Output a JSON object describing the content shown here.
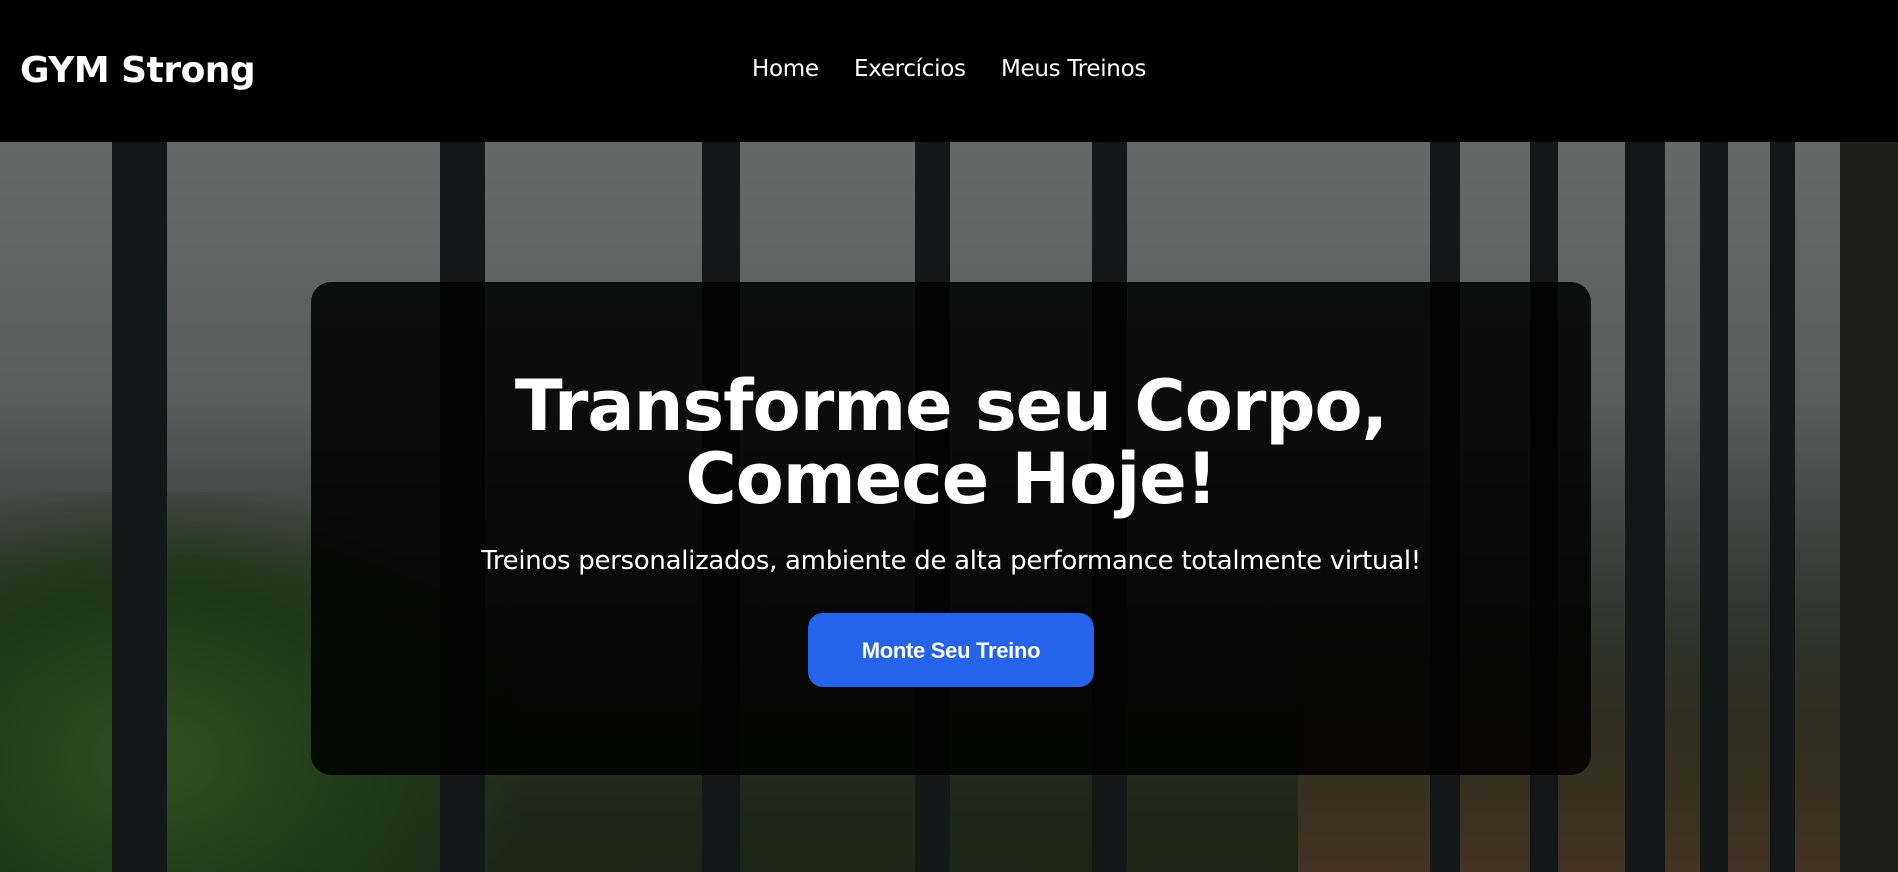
{
  "header": {
    "logo": "GYM Strong",
    "nav": [
      {
        "label": "Home"
      },
      {
        "label": "Exercícios"
      },
      {
        "label": "Meus Treinos"
      }
    ]
  },
  "hero": {
    "title_line1": "Transforme seu Corpo,",
    "title_line2": "Comece Hoje!",
    "subtitle": "Treinos personalizados, ambiente de alta performance totalmente virtual!",
    "cta_label": "Monte Seu Treino",
    "background": "gym-treadmill-photo"
  },
  "colors": {
    "accent": "#2563eb",
    "header_bg": "#000000"
  }
}
